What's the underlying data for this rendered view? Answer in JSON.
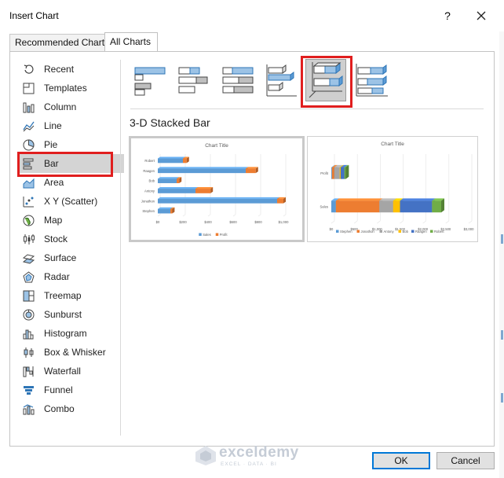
{
  "window": {
    "title": "Insert Chart",
    "help_label": "?"
  },
  "tabs": [
    {
      "label": "Recommended Charts",
      "active": false
    },
    {
      "label": "All Charts",
      "active": true
    }
  ],
  "chart_types": [
    {
      "label": "Recent",
      "icon": "recent-icon"
    },
    {
      "label": "Templates",
      "icon": "templates-icon"
    },
    {
      "label": "Column",
      "icon": "column-chart-icon"
    },
    {
      "label": "Line",
      "icon": "line-chart-icon"
    },
    {
      "label": "Pie",
      "icon": "pie-chart-icon"
    },
    {
      "label": "Bar",
      "icon": "bar-chart-icon",
      "selected": true
    },
    {
      "label": "Area",
      "icon": "area-chart-icon"
    },
    {
      "label": "X Y (Scatter)",
      "icon": "scatter-chart-icon"
    },
    {
      "label": "Map",
      "icon": "map-chart-icon"
    },
    {
      "label": "Stock",
      "icon": "stock-chart-icon"
    },
    {
      "label": "Surface",
      "icon": "surface-chart-icon"
    },
    {
      "label": "Radar",
      "icon": "radar-chart-icon"
    },
    {
      "label": "Treemap",
      "icon": "treemap-chart-icon"
    },
    {
      "label": "Sunburst",
      "icon": "sunburst-chart-icon"
    },
    {
      "label": "Histogram",
      "icon": "histogram-chart-icon"
    },
    {
      "label": "Box & Whisker",
      "icon": "box-whisker-chart-icon"
    },
    {
      "label": "Waterfall",
      "icon": "waterfall-chart-icon"
    },
    {
      "label": "Funnel",
      "icon": "funnel-chart-icon"
    },
    {
      "label": "Combo",
      "icon": "combo-chart-icon"
    }
  ],
  "subtypes": [
    {
      "icon": "clustered-bar-icon"
    },
    {
      "icon": "stacked-bar-icon"
    },
    {
      "icon": "100-stacked-bar-icon"
    },
    {
      "icon": "3d-clustered-bar-icon"
    },
    {
      "icon": "3d-stacked-bar-icon",
      "selected": true
    },
    {
      "icon": "3d-100-stacked-bar-icon"
    }
  ],
  "selected_subtype_name": "3-D Stacked Bar",
  "colors": {
    "series1": "#5b9bd5",
    "series2": "#ed7d31",
    "series3": "#a5a5a5",
    "series4": "#ffc000",
    "series5": "#4472c4",
    "series6": "#70ad47",
    "highlight": "#e01e1e",
    "accent": "#0078d7"
  },
  "previews": [
    {
      "chart_data": {
        "type": "bar",
        "title": "Chart Title",
        "categories": [
          "Stephen",
          "Jonathon",
          "Antony",
          "Bob",
          "Raagen",
          "Robert"
        ],
        "series": [
          {
            "name": "Sales",
            "values": [
              100,
              950,
              300,
              150,
              700,
              200
            ]
          },
          {
            "name": "Profit",
            "values": [
              15,
              50,
              120,
              20,
              80,
              30
            ]
          }
        ],
        "x_ticks": [
          "$0",
          "$200",
          "$400",
          "$600",
          "$800",
          "$1,000"
        ],
        "xlim": [
          0,
          1000
        ],
        "stacked": true,
        "legend": "bottom",
        "grid": true
      }
    },
    {
      "chart_data": {
        "type": "bar",
        "title": "Chart Title",
        "categories": [
          "Sales",
          "Profit"
        ],
        "series": [
          {
            "name": "Stephen",
            "values": [
              100,
              15
            ]
          },
          {
            "name": "Jonathon",
            "values": [
              950,
              50
            ]
          },
          {
            "name": "Antony",
            "values": [
              300,
              120
            ]
          },
          {
            "name": "Bob",
            "values": [
              150,
              20
            ]
          },
          {
            "name": "Raagen",
            "values": [
              700,
              80
            ]
          },
          {
            "name": "Robert",
            "values": [
              200,
              30
            ]
          }
        ],
        "x_ticks": [
          "$0",
          "$500",
          "$1,000",
          "$1,500",
          "$2,000",
          "$2,500",
          "$3,000"
        ],
        "xlim": [
          0,
          3000
        ],
        "stacked": true,
        "legend": "bottom",
        "grid": true
      }
    }
  ],
  "watermark": {
    "main": "exceldemy",
    "sub": "EXCEL · DATA · BI"
  },
  "buttons": {
    "ok": "OK",
    "cancel": "Cancel"
  }
}
